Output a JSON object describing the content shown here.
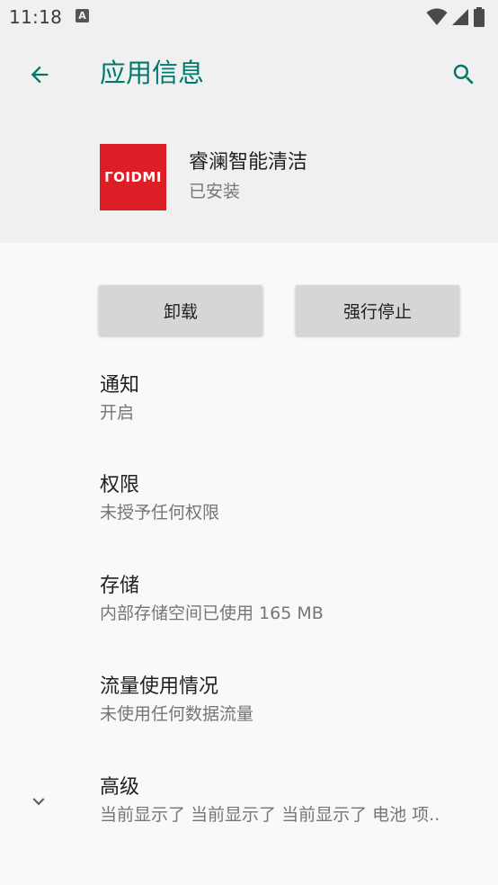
{
  "status_bar": {
    "time": "11:18",
    "notification_icon": "A"
  },
  "header": {
    "title": "应用信息",
    "back_icon": "arrow-left-icon",
    "search_icon": "search-icon"
  },
  "app": {
    "name": "睿澜智能清洁",
    "status": "已安装",
    "logo_text": "ΓOIDMI",
    "logo_color": "#dc1f26"
  },
  "buttons": {
    "uninstall": "卸载",
    "force_stop": "强行停止"
  },
  "prefs": [
    {
      "title": "通知",
      "summary": "开启"
    },
    {
      "title": "权限",
      "summary": "未授予任何权限"
    },
    {
      "title": "存储",
      "summary": "内部存储空间已使用 165 MB"
    },
    {
      "title": "流量使用情况",
      "summary": "未使用任何数据流量"
    },
    {
      "title": "高级",
      "summary": "当前显示了 当前显示了 当前显示了 电池 项.."
    }
  ],
  "colors": {
    "accent": "#00796b",
    "background": "#f9f9f9",
    "header_bg": "#f0f0f0"
  }
}
